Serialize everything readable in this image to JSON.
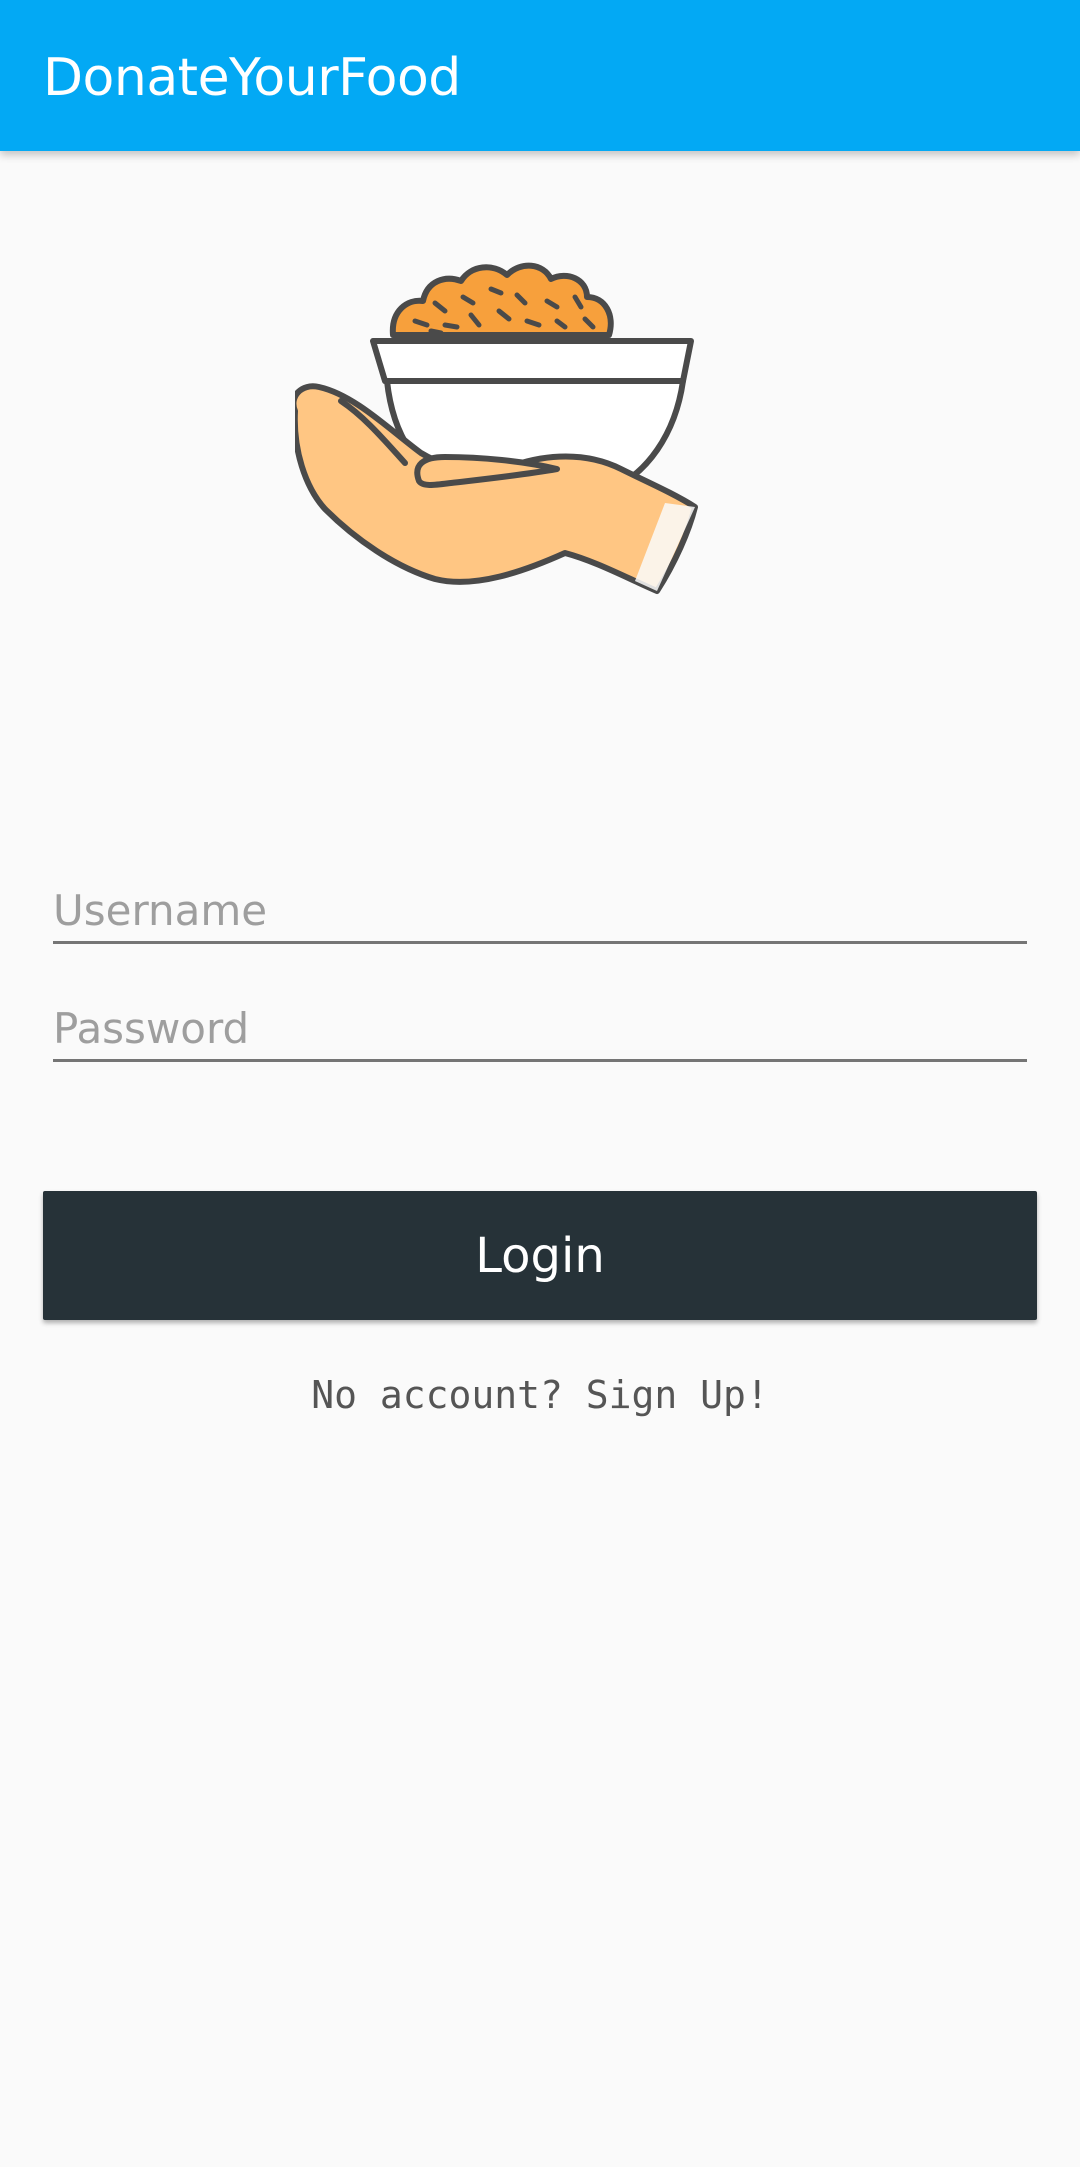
{
  "app_bar": {
    "title": "DonateYourFood",
    "color": "#03a9f4"
  },
  "logo": {
    "icon": "hand-holding-food-bowl-icon"
  },
  "form": {
    "username": {
      "value": "",
      "placeholder": "Username"
    },
    "password": {
      "value": "",
      "placeholder": "Password"
    }
  },
  "actions": {
    "login_label": "Login",
    "login_color": "#263238",
    "signup_label": "No account? Sign Up!"
  }
}
